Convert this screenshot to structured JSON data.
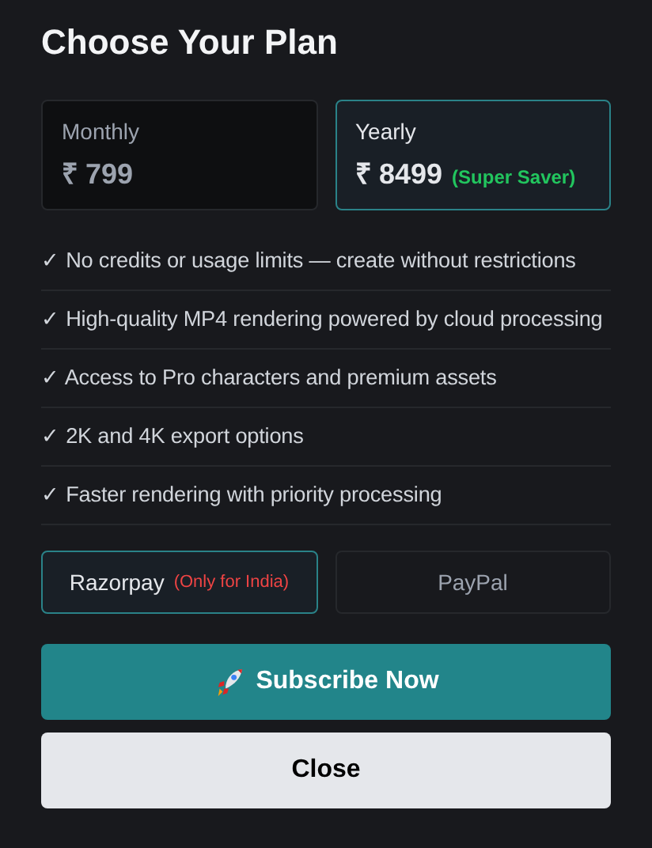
{
  "title": "Choose Your Plan",
  "plans": [
    {
      "label": "Monthly",
      "price": "₹ 799",
      "selected": false
    },
    {
      "label": "Yearly",
      "price": "₹ 8499",
      "note": "(Super Saver)",
      "selected": true
    }
  ],
  "features": [
    "✓ No credits or usage limits — create without restrictions",
    "✓ High-quality MP4 rendering powered by cloud processing",
    "✓ Access to Pro characters and premium assets",
    "✓ 2K and 4K export options",
    "✓ Faster rendering with priority processing"
  ],
  "payment_methods": [
    {
      "label": "Razorpay",
      "note": "(Only for India)",
      "selected": true
    },
    {
      "label": "PayPal",
      "selected": false
    }
  ],
  "subscribe_button": "Subscribe Now",
  "close_button": "Close"
}
